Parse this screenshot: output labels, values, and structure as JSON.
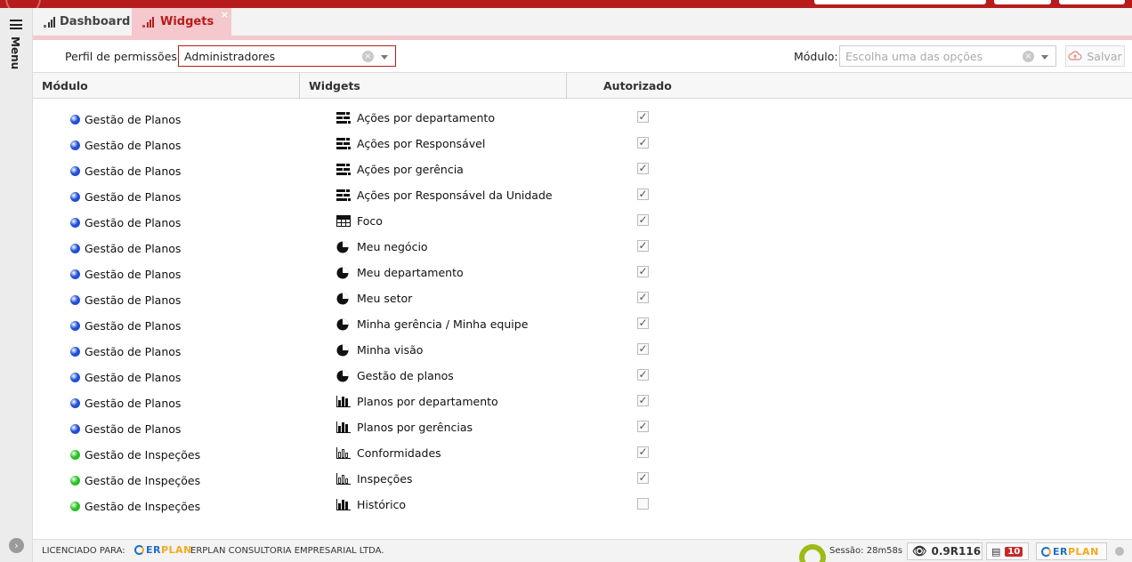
{
  "tabs": [
    {
      "label": "Dashboard",
      "icon": "bar-chart-icon",
      "active": false
    },
    {
      "label": "Widgets",
      "icon": "bar-chart-icon",
      "active": true,
      "close": "×"
    }
  ],
  "sidebar": {
    "menu_label": "Menu",
    "expand_icon": "chevron-right-icon"
  },
  "filters": {
    "perfil_label": "Perfil de permissões:",
    "perfil_value": "Administradores",
    "modulo_label": "Módulo:",
    "modulo_placeholder": "Escolha uma das opções",
    "save_label": "Salvar",
    "clear_glyph": "×"
  },
  "columns": [
    "Módulo",
    "Widgets",
    "Autorizado"
  ],
  "colors": {
    "brand_red": "#b71c1c",
    "tab_active_bg": "#f4c8cc",
    "module_blue": "#1f4fd6",
    "module_green": "#27c21f",
    "session_green": "#9cbb16"
  },
  "rows": [
    {
      "module": "Gestão de Planos",
      "module_color": "blue",
      "widget": "Ações por departamento",
      "icon": "stacked-list-icon",
      "authorized": true
    },
    {
      "module": "Gestão de Planos",
      "module_color": "blue",
      "widget": "Ações por Responsável",
      "icon": "stacked-list-icon",
      "authorized": true
    },
    {
      "module": "Gestão de Planos",
      "module_color": "blue",
      "widget": "Ações por gerência",
      "icon": "stacked-list-icon",
      "authorized": true
    },
    {
      "module": "Gestão de Planos",
      "module_color": "blue",
      "widget": "Ações por Responsável da Unidade",
      "icon": "stacked-list-icon",
      "authorized": true
    },
    {
      "module": "Gestão de Planos",
      "module_color": "blue",
      "widget": "Foco",
      "icon": "table-icon",
      "authorized": true
    },
    {
      "module": "Gestão de Planos",
      "module_color": "blue",
      "widget": "Meu negócio",
      "icon": "pie-chart-icon",
      "authorized": true
    },
    {
      "module": "Gestão de Planos",
      "module_color": "blue",
      "widget": "Meu departamento",
      "icon": "pie-chart-icon",
      "authorized": true
    },
    {
      "module": "Gestão de Planos",
      "module_color": "blue",
      "widget": "Meu setor",
      "icon": "pie-chart-icon",
      "authorized": true
    },
    {
      "module": "Gestão de Planos",
      "module_color": "blue",
      "widget": "Minha gerência / Minha equipe",
      "icon": "pie-chart-icon",
      "authorized": true
    },
    {
      "module": "Gestão de Planos",
      "module_color": "blue",
      "widget": "Minha visão",
      "icon": "pie-chart-icon",
      "authorized": true
    },
    {
      "module": "Gestão de Planos",
      "module_color": "blue",
      "widget": "Gestão de planos",
      "icon": "pie-chart-icon",
      "authorized": true
    },
    {
      "module": "Gestão de Planos",
      "module_color": "blue",
      "widget": "Planos por departamento",
      "icon": "bar-chart-icon",
      "authorized": true
    },
    {
      "module": "Gestão de Planos",
      "module_color": "blue",
      "widget": "Planos por gerências",
      "icon": "bar-chart-icon",
      "authorized": true
    },
    {
      "module": "Gestão de Inspeções",
      "module_color": "green",
      "widget": "Conformidades",
      "icon": "bar-chart-outline-icon",
      "authorized": true
    },
    {
      "module": "Gestão de Inspeções",
      "module_color": "green",
      "widget": "Inspeções",
      "icon": "bar-chart-outline-icon",
      "authorized": true
    },
    {
      "module": "Gestão de Inspeções",
      "module_color": "green",
      "widget": "Histórico",
      "icon": "bar-chart-icon",
      "authorized": false
    }
  ],
  "footer": {
    "license_label": "LICENCIADO PARA:",
    "logo_part1": "ER",
    "logo_part2": "PLAN",
    "company": "ERPLAN CONSULTORIA EMPRESARIAL LTDA.",
    "session": "Sessão: 28m58s",
    "version": "0.9R116",
    "badge": "10",
    "check_glyph": "✓"
  }
}
